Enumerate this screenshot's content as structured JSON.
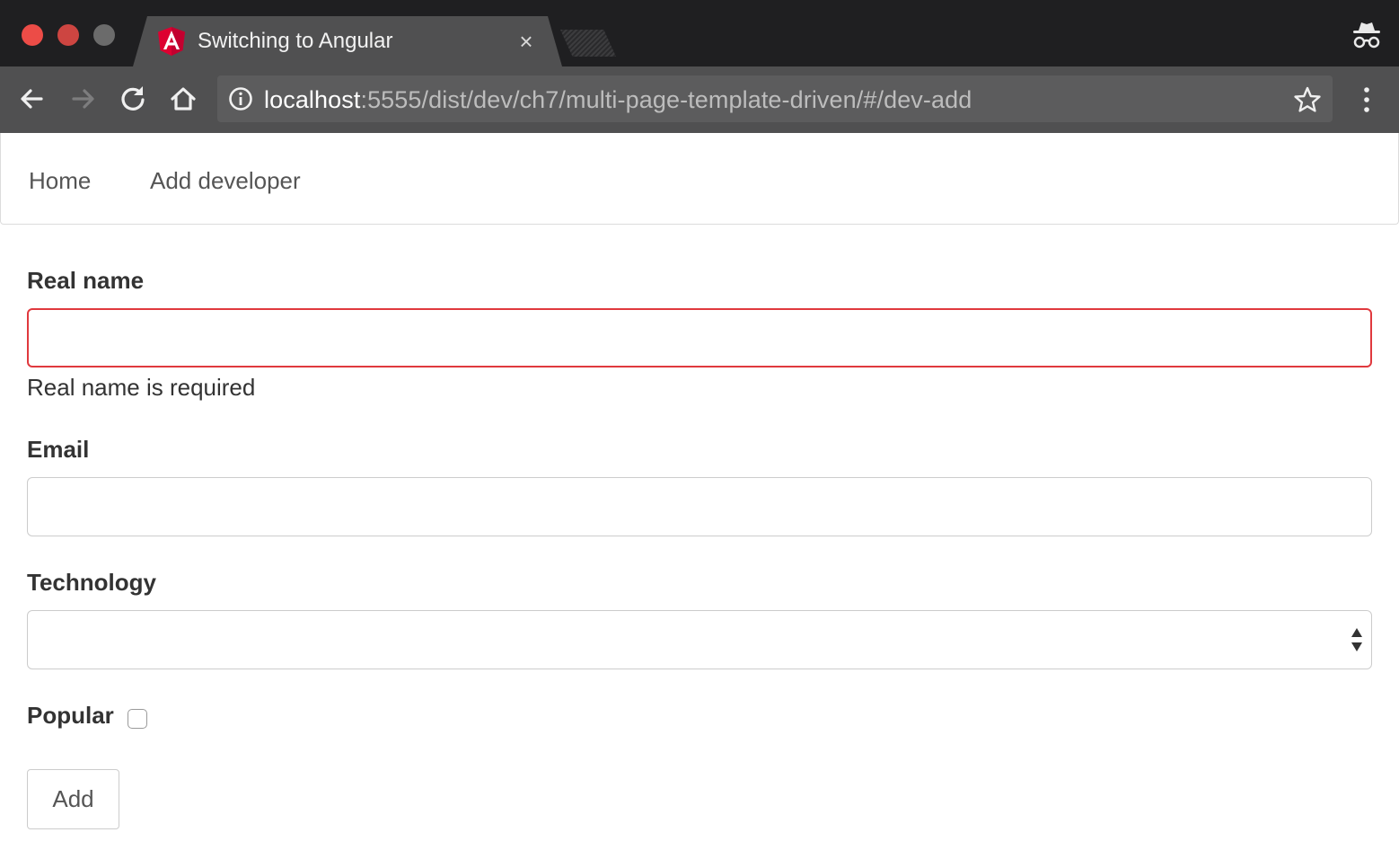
{
  "browser": {
    "tab_title": "Switching to Angular",
    "tab_close_glyph": "×",
    "url_host": "localhost",
    "url_rest": ":5555/dist/dev/ch7/multi-page-template-driven/#/dev-add",
    "colors": {
      "titlebar": "#1f1f21",
      "toolbar": "#505051",
      "angular_red": "#dd0031",
      "error_red": "#e0393e"
    },
    "icons": [
      "traffic-close-icon",
      "traffic-minimize-icon",
      "traffic-maximize-icon",
      "angular-favicon-icon",
      "tab-close-icon",
      "new-tab-icon",
      "incognito-icon",
      "back-arrow-icon",
      "forward-arrow-icon",
      "reload-icon",
      "home-icon",
      "info-icon",
      "star-icon",
      "menu-icon"
    ]
  },
  "nav": {
    "home": "Home",
    "add_developer": "Add developer"
  },
  "form": {
    "real_name_label": "Real name",
    "real_name_value": "",
    "real_name_error": "Real name is required",
    "email_label": "Email",
    "email_value": "",
    "technology_label": "Technology",
    "technology_selected": "",
    "popular_label": "Popular",
    "popular_checked": false,
    "add_button": "Add"
  }
}
